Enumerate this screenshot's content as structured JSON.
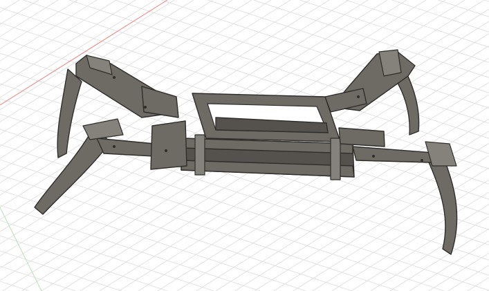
{
  "viewport": {
    "background": "#ffffff",
    "grid_color": "#dcdcdc",
    "x_axis_color": "#f08080",
    "y_axis_color": "#9fd89f",
    "model_color": "#6e6b65",
    "edge_color": "#2f2d2a"
  }
}
